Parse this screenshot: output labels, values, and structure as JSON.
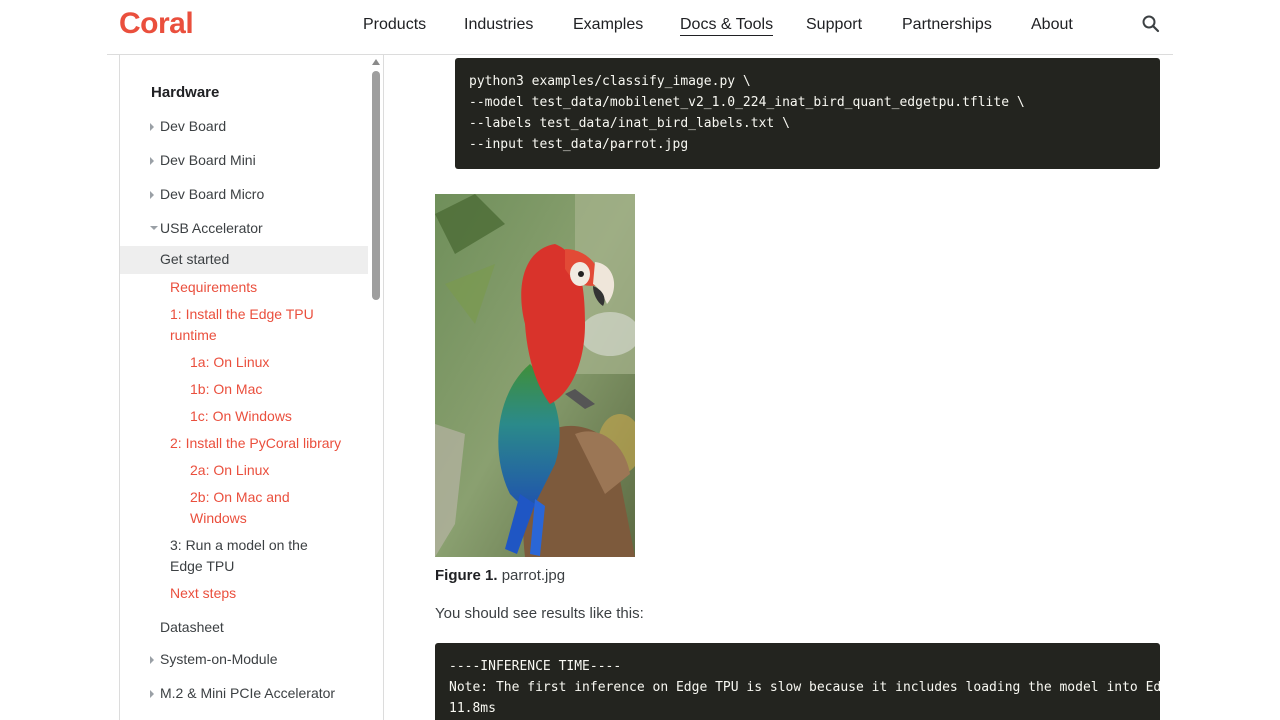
{
  "brand": {
    "logo": "Coral",
    "accent": "#ea4f3d"
  },
  "nav": {
    "items": [
      {
        "label": "Products"
      },
      {
        "label": "Industries"
      },
      {
        "label": "Examples"
      },
      {
        "label": "Docs & Tools",
        "active": true
      },
      {
        "label": "Support"
      },
      {
        "label": "Partnerships"
      },
      {
        "label": "About"
      }
    ],
    "search_icon": "search-icon"
  },
  "sidebar": {
    "heading": "Hardware",
    "items": [
      {
        "label": "Dev Board"
      },
      {
        "label": "Dev Board Mini"
      },
      {
        "label": "Dev Board Micro"
      },
      {
        "label": "USB Accelerator"
      },
      {
        "label": "Get started"
      },
      {
        "label": "Requirements"
      },
      {
        "label": "1: Install the Edge TPU runtime"
      },
      {
        "label": "1a: On Linux"
      },
      {
        "label": "1b: On Mac"
      },
      {
        "label": "1c: On Windows"
      },
      {
        "label": "2: Install the PyCoral library"
      },
      {
        "label": "2a: On Linux"
      },
      {
        "label": "2b: On Mac and Windows"
      },
      {
        "label": "3: Run a model on the Edge TPU"
      },
      {
        "label": "Next steps"
      },
      {
        "label": "Datasheet"
      },
      {
        "label": "System-on-Module"
      },
      {
        "label": "M.2 & Mini PCIe Accelerator"
      }
    ]
  },
  "main": {
    "command_lines": [
      "python3 examples/classify_image.py \\",
      "--model test_data/mobilenet_v2_1.0_224_inat_bird_quant_edgetpu.tflite \\",
      "--labels test_data/inat_bird_labels.txt \\",
      "--input test_data/parrot.jpg"
    ],
    "figure": {
      "label": "Figure 1.",
      "text": "parrot.jpg"
    },
    "paragraph": "You should see results like this:",
    "output_lines": [
      "----INFERENCE TIME----",
      "Note: The first inference on Edge TPU is slow because it includes loading the model into Edge TPU memory.",
      "11.8ms"
    ]
  }
}
